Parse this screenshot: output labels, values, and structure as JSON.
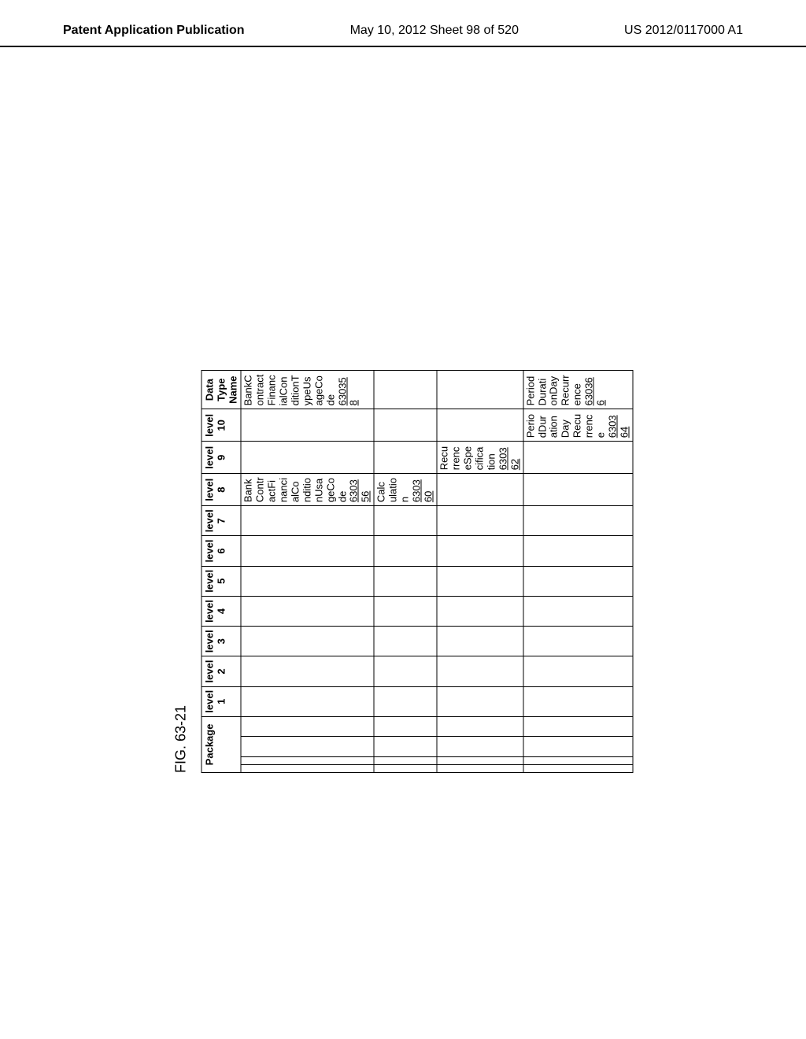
{
  "header": {
    "left": "Patent Application Publication",
    "center": "May 10, 2012  Sheet 98 of 520",
    "right": "US 2012/0117000 A1"
  },
  "figure_label": "FIG. 63-21",
  "columns": {
    "package": "Package",
    "level1": "level 1",
    "level2": "level 2",
    "level3": "level 3",
    "level4": "level 4",
    "level5": "level 5",
    "level6": "level 6",
    "level7": "level 7",
    "level8": "level 8",
    "level9": "level 9",
    "level10": "level 10",
    "datatype": "Data Type Name"
  },
  "rows": [
    {
      "level8": "BankContractFinancialConditionUsageCode",
      "level8_ref": "630356",
      "datatype": "BankContractFinancialConditionTypeUsageCode",
      "datatype_ref": "630358"
    },
    {
      "level8": "Calculation",
      "level8_ref": "630360"
    },
    {
      "level9": "RecurrenceSpecification",
      "level9_ref": "630362"
    },
    {
      "level10": "PeriodDurationDayRecurrence",
      "level10_ref": "630364",
      "datatype": "PeriodDurationDayRecurrence",
      "datatype_ref": "630366"
    }
  ]
}
